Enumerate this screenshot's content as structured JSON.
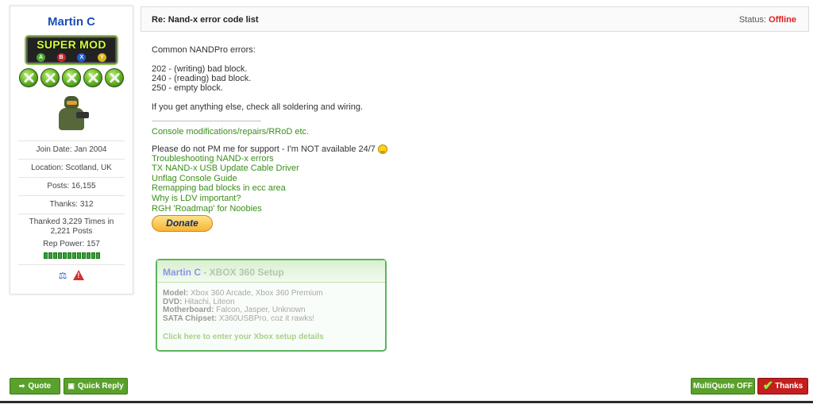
{
  "user": {
    "name": "Martin C",
    "badge_text": "SUPER MOD",
    "badge_buttons": [
      "A",
      "B",
      "X",
      "Y"
    ],
    "rank_icons": 5,
    "join_date": "Join Date: Jan 2004",
    "location": "Location: Scotland, UK",
    "posts": "Posts: 16,155",
    "thanks": "Thanks: 312",
    "thanked_line1": "Thanked 3,229 Times in",
    "thanked_line2": "2,221 Posts",
    "rep_power": "Rep Power: 157",
    "rep_segments": 12
  },
  "post": {
    "title": "Re: Nand-x error code list",
    "status_label": "Status:",
    "status_value": "Offline",
    "status_color": "#e02020",
    "intro": "Common NANDPro errors:",
    "errors": [
      "202 - (writing) bad block.",
      "240 - (reading) bad block.",
      "250 - empty block."
    ],
    "advice": "If you get anything else, check all soldering and wiring."
  },
  "signature": {
    "separator": "-------------------------------------------------------",
    "link_console": "Console modifications/repairs/RRoD etc.",
    "pm_notice": "Please do not PM me for support - I'm NOT available 24/7",
    "links": [
      "Troubleshooting NAND-x errors",
      "TX NAND-x USB Update Cable Driver",
      "Unflag Console Guide",
      "Remapping bad blocks in ecc area",
      "Why is LDV important?",
      "RGH 'Roadmap' for Noobies"
    ],
    "donate_label": "Donate"
  },
  "setup": {
    "owner": "Martin C",
    "title_rest": " - XBOX 360 Setup",
    "rows": [
      {
        "label": "Model:",
        "value": " Xbox 360 Arcade, Xbox 360 Premium"
      },
      {
        "label": "DVD:",
        "value": " Hitachi, Liteon"
      },
      {
        "label": "Motherboard:",
        "value": " Falcon, Jasper, Unknown"
      },
      {
        "label": "SATA Chipset:",
        "value": " X360USBPro, coz it rawks!"
      }
    ],
    "link": "Click here to enter your Xbox setup details"
  },
  "buttons": {
    "quote": "Quote",
    "quick_reply": "Quick Reply",
    "multiquote": "MultiQuote OFF",
    "thanks": "Thanks"
  },
  "colors": {
    "button_green": "#5aa02c",
    "button_red": "#c41e1e",
    "link_green": "#3a8f1a",
    "username_blue": "#1a4fb8"
  }
}
